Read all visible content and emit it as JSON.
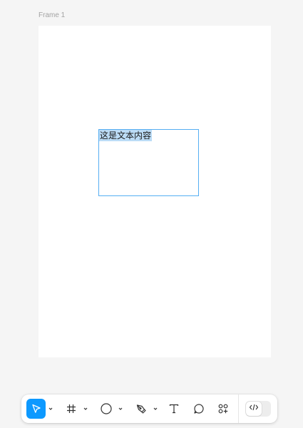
{
  "canvas": {
    "frame_label": "Frame 1",
    "text_box": {
      "content": "这是文本内容"
    }
  },
  "toolbar": {
    "tools": [
      {
        "name": "move-tool",
        "icon": "cursor-arrow-icon",
        "active": true,
        "has_menu": true
      },
      {
        "name": "frame-tool",
        "icon": "hash-frame-icon",
        "active": false,
        "has_menu": true
      },
      {
        "name": "shape-tool",
        "icon": "ellipse-icon",
        "active": false,
        "has_menu": true
      },
      {
        "name": "pen-tool",
        "icon": "pen-nib-icon",
        "active": false,
        "has_menu": true
      },
      {
        "name": "text-tool",
        "icon": "text-t-icon",
        "active": false,
        "has_menu": false
      },
      {
        "name": "comment-tool",
        "icon": "comment-bubble-icon",
        "active": false,
        "has_menu": false
      },
      {
        "name": "actions-tool",
        "icon": "components-plus-icon",
        "active": false,
        "has_menu": false
      }
    ],
    "dev_mode": {
      "icon": "code-brackets-icon",
      "enabled": false
    }
  },
  "colors": {
    "accent": "#0d99ff",
    "selection_border": "#55aef2",
    "text_highlight": "#bcdcf6",
    "canvas_background": "#f5f5f5",
    "frame_background": "#ffffff"
  }
}
